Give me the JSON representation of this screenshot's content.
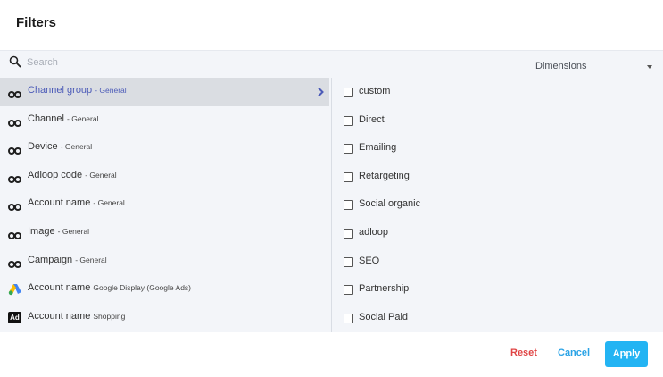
{
  "dialog": {
    "title": "Filters"
  },
  "search": {
    "placeholder": "Search",
    "value": ""
  },
  "dimensions": {
    "label": "Dimensions"
  },
  "items": [
    {
      "name": "Channel group",
      "source": "- General",
      "icon": "infinity-icon",
      "active": true
    },
    {
      "name": "Channel",
      "source": "- General",
      "icon": "infinity-icon"
    },
    {
      "name": "Device",
      "source": "- General",
      "icon": "infinity-icon"
    },
    {
      "name": "Adloop code",
      "source": "- General",
      "icon": "infinity-icon"
    },
    {
      "name": "Account name",
      "source": "- General",
      "icon": "infinity-icon"
    },
    {
      "name": "Image",
      "source": "- General",
      "icon": "infinity-icon"
    },
    {
      "name": "Campaign",
      "source": "- General",
      "icon": "infinity-icon"
    },
    {
      "name": "Account name",
      "source": "Google Display (Google Ads)",
      "icon": "google-ads-icon"
    },
    {
      "name": "Account name",
      "source": "Shopping",
      "icon": "ad-icon",
      "icon_text": "Ad"
    }
  ],
  "options": [
    {
      "label": "custom",
      "checked": false
    },
    {
      "label": "Direct",
      "checked": false
    },
    {
      "label": "Emailing",
      "checked": false
    },
    {
      "label": "Retargeting",
      "checked": false
    },
    {
      "label": "Social organic",
      "checked": false
    },
    {
      "label": "adloop",
      "checked": false
    },
    {
      "label": "SEO",
      "checked": false
    },
    {
      "label": "Partnership",
      "checked": false
    },
    {
      "label": "Social Paid",
      "checked": false
    }
  ],
  "footer": {
    "reset": "Reset",
    "cancel": "Cancel",
    "apply": "Apply"
  },
  "colors": {
    "accent": "#23b4f3",
    "reset": "#e04545",
    "active_text": "#4c5bb8"
  }
}
